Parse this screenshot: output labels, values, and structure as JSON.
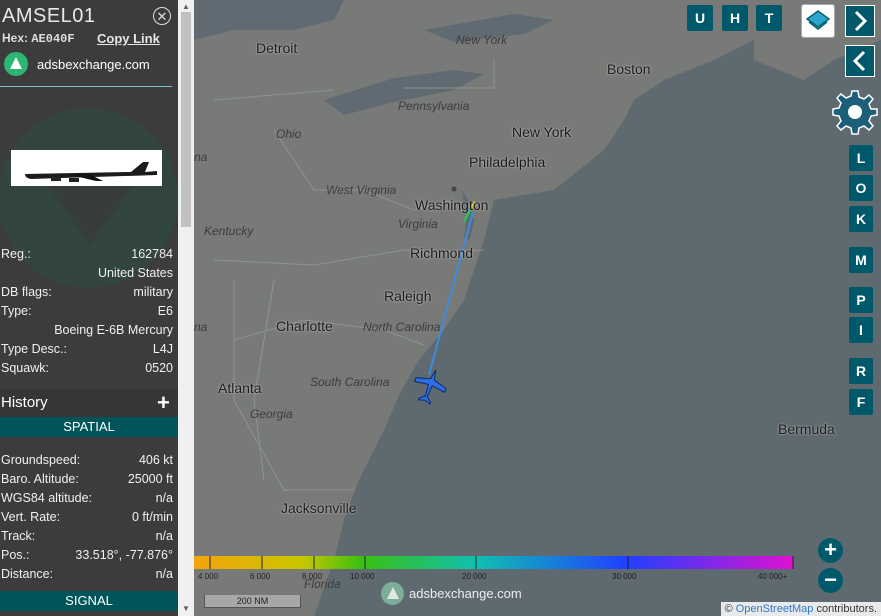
{
  "sidebar": {
    "callsign": "AMSEL01",
    "hex_label": "Hex:",
    "hex_value": "AE040F",
    "copy_link": "Copy Link",
    "site_name": "adsbexchange.com",
    "details": [
      {
        "key": "Reg.:",
        "value": "162784"
      },
      {
        "key": "",
        "value": "United States"
      },
      {
        "key": "DB flags:",
        "value": "military"
      },
      {
        "key": "Type:",
        "value": "E6"
      },
      {
        "key": "",
        "value": "Boeing E-6B Mercury"
      },
      {
        "key": "Type Desc.:",
        "value": "L4J"
      },
      {
        "key": "Squawk:",
        "value": "0520"
      }
    ],
    "history_label": "History",
    "spatial_label": "SPATIAL",
    "spatial": [
      {
        "key": "Groundspeed:",
        "value": "406 kt"
      },
      {
        "key": "Baro. Altitude:",
        "value": "25000 ft"
      },
      {
        "key": "WGS84 altitude:",
        "value": "n/a"
      },
      {
        "key": "Vert. Rate:",
        "value": "0 ft/min"
      },
      {
        "key": "Track:",
        "value": "n/a"
      },
      {
        "key": "Pos.:",
        "value": "33.518°, -77.876°"
      },
      {
        "key": "Distance:",
        "value": "n/a"
      }
    ],
    "signal_label": "SIGNAL"
  },
  "map": {
    "top_buttons": [
      "U",
      "H",
      "T"
    ],
    "side_buttons": [
      "L",
      "O",
      "K",
      "M",
      "P",
      "I",
      "R",
      "F"
    ],
    "labels": [
      {
        "text": "Detroit",
        "type": "city"
      },
      {
        "text": "New York",
        "type": "state"
      },
      {
        "text": "Boston",
        "type": "city"
      },
      {
        "text": "Pennsylvania",
        "type": "state"
      },
      {
        "text": "Ohio",
        "type": "state"
      },
      {
        "text": "New York",
        "type": "city"
      },
      {
        "text": "Philadelphia",
        "type": "city"
      },
      {
        "text": "West Virginia",
        "type": "state"
      },
      {
        "text": "Washington",
        "type": "city"
      },
      {
        "text": "Kentucky",
        "type": "state"
      },
      {
        "text": "Virginia",
        "type": "state"
      },
      {
        "text": "Richmond",
        "type": "city"
      },
      {
        "text": "Raleigh",
        "type": "city"
      },
      {
        "text": "Charlotte",
        "type": "city"
      },
      {
        "text": "North Carolina",
        "type": "state"
      },
      {
        "text": "Atlanta",
        "type": "city"
      },
      {
        "text": "South Carolina",
        "type": "state"
      },
      {
        "text": "Georgia",
        "type": "state"
      },
      {
        "text": "Bermuda",
        "type": "city"
      },
      {
        "text": "Jacksonville",
        "type": "city"
      },
      {
        "text": "na",
        "type": "state"
      },
      {
        "text": "na",
        "type": "state"
      },
      {
        "text": "Florida",
        "type": "state"
      }
    ],
    "altitude_legend": [
      "4 000",
      "6 000",
      "8 000",
      "10 000",
      "20 000",
      "30 000",
      "40 000+"
    ],
    "scale_label": "200 NM",
    "watermark": "adsbexchange.com",
    "attribution_prefix": "©",
    "attribution_link": "OpenStreetMap",
    "attribution_suffix": "contributors."
  },
  "colors": {
    "button": "#00596b",
    "track": "#3a8de0",
    "aircraft": "#2f6fe6",
    "section_bar": "#00545a",
    "sidebar_bg": "#3c3c3c"
  }
}
